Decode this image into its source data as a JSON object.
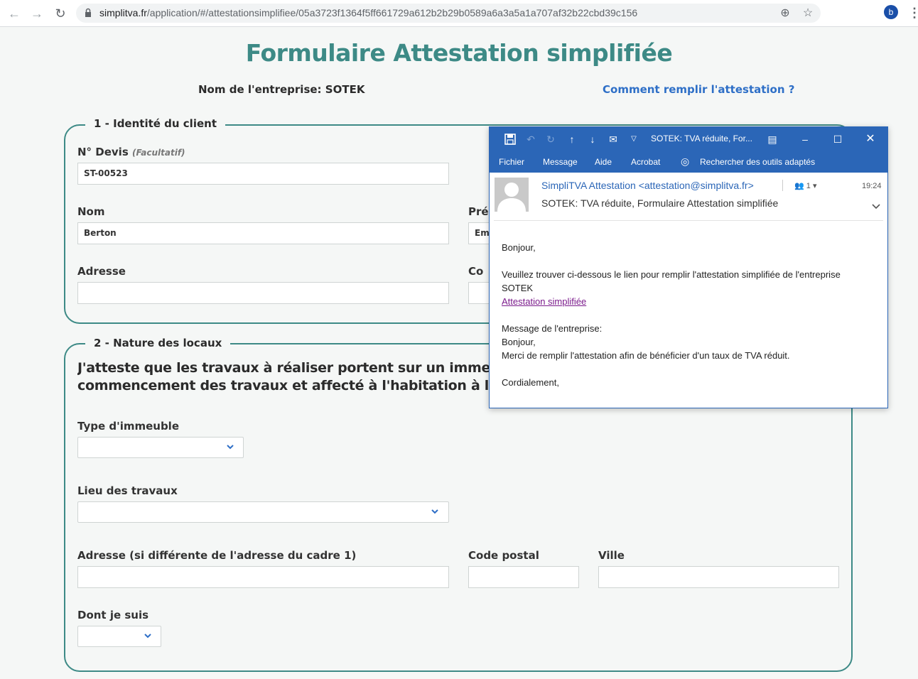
{
  "browser": {
    "url_host": "simplitva.fr",
    "url_path": "/application/#/attestationsimplifiee/05a3723f1364f5ff661729a612b2b29b0589a6a3a5a1a707af32b22cbd39c156",
    "avatar_letter": "b"
  },
  "page": {
    "title": "Formulaire Attestation simplifiée",
    "company_label": "Nom de l'entreprise:",
    "company_name": "SOTEK",
    "help_link": "Comment remplir l'attestation ?"
  },
  "section1": {
    "legend": "1 - Identité du client",
    "devis_label": "N° Devis",
    "devis_hint": "(Facultatif)",
    "devis_value": "ST-00523",
    "nom_label": "Nom",
    "nom_value": "Berton",
    "prenom_label_partial": "Pré",
    "prenom_value_partial": "Em",
    "adresse_label": "Adresse",
    "adresse_value": "",
    "code_label_partial": "Co"
  },
  "section2": {
    "legend": "2 - Nature des locaux",
    "statement_line1": "J'atteste que les travaux à réaliser portent sur un immeu",
    "statement_line2": "commencement des travaux et affecté à l'habitation à l'i",
    "type_label": "Type d'immeuble",
    "type_value": "",
    "lieu_label": "Lieu des travaux",
    "lieu_value": "",
    "adresse_label": "Adresse (si différente de l'adresse du cadre 1)",
    "adresse_value": "",
    "cp_label": "Code postal",
    "cp_value": "",
    "ville_label": "Ville",
    "ville_value": "",
    "dont_label": "Dont je suis",
    "dont_value": ""
  },
  "mail": {
    "window_title": "SOTEK: TVA réduite, For...",
    "ribbon": [
      "Fichier",
      "Message",
      "Aide",
      "Acrobat"
    ],
    "search_tools": "Rechercher des outils adaptés",
    "sender": "SimpliTVA Attestation <attestation@simplitva.fr>",
    "people_count": "1",
    "time": "19:24",
    "subject": "SOTEK: TVA réduite, Formulaire Attestation simplifiée",
    "body": {
      "greeting": "Bonjour,",
      "line1": "Veuillez trouver ci-dessous le lien pour remplir l'attestation simplifiée de l'entreprise",
      "line2": "SOTEK",
      "link": "Attestation simplifiée",
      "msg_label": "Message de l'entreprise:",
      "msg_greeting": "Bonjour,",
      "msg_text": "Merci de remplir l'attestation afin de bénéficier d'un taux de TVA réduit.",
      "closing": "Cordialement,"
    }
  },
  "colors": {
    "teal": "#3d8a86",
    "link_blue": "#2e6fc7",
    "outlook_blue": "#2b66b7",
    "visited_link": "#7b1b8c"
  }
}
